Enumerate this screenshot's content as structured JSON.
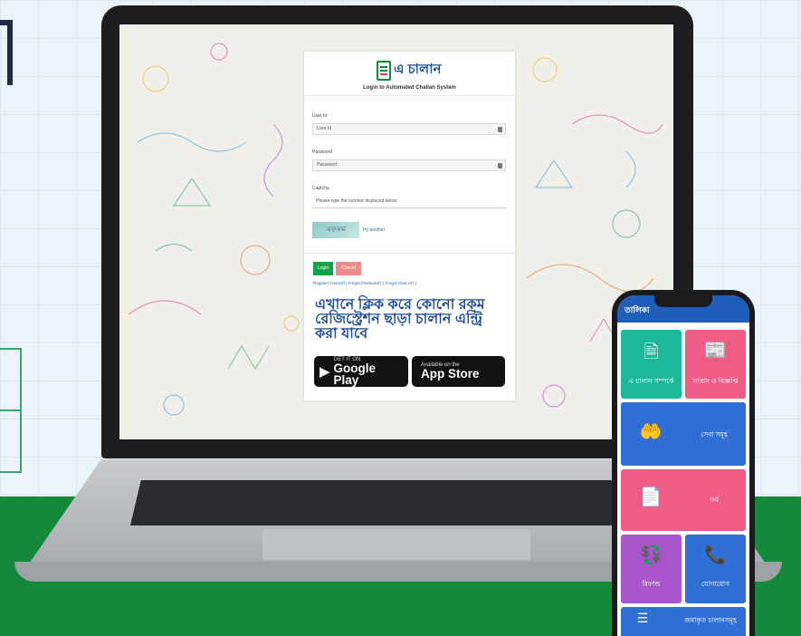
{
  "login": {
    "logo_text": "এ চালান",
    "subtitle": "Login to Automated Challan System",
    "user_id_label": "User Id",
    "user_id_placeholder": "User Id",
    "password_label": "Password",
    "password_placeholder": "Password",
    "captcha_label": "Captcha",
    "captcha_placeholder": "Please type the number displayed below",
    "captcha_text": "ঝড়ঝঝ",
    "try_another": "Try another",
    "login_button": "Login",
    "cancel_button": "Cancel",
    "register_link": "Register Yourself",
    "forgot_password_link": "Forgot Password?",
    "forgot_userid_link": "Forgot User Id?"
  },
  "promo": {
    "text": "এখানে ক্লিক করে কোনো রকম রেজিস্ট্রেশন ছাড়া চালান এন্ট্রি করা যাবে",
    "google_play_small": "GET IT ON",
    "google_play_big": "Google Play",
    "app_store_small": "Available on the",
    "app_store_big": "App Store"
  },
  "phone": {
    "header_title": "তালিকা",
    "tiles": [
      {
        "label": "এ চালান সম্পর্কে",
        "icon": "document-icon",
        "color": "#19b99a"
      },
      {
        "label": "সংবাদ ও বিজ্ঞপ্তি",
        "icon": "newspaper-icon",
        "color": "#ef5c86"
      },
      {
        "label": "সেবা সমূহ",
        "icon": "service-hand-icon",
        "color": "#2f6fd6"
      },
      {
        "label": "ফর্ম",
        "icon": "form-icon",
        "color": "#ef5c86"
      },
      {
        "label": "রিফান্ড",
        "icon": "refund-icon",
        "color": "#a855c9"
      },
      {
        "label": "যোগাযোগ",
        "icon": "phone-contact-icon",
        "color": "#2f6fd6"
      },
      {
        "label": "জমাকৃত চালানসমূহ",
        "icon": "list-icon",
        "color": "#2f6fd6"
      }
    ]
  }
}
